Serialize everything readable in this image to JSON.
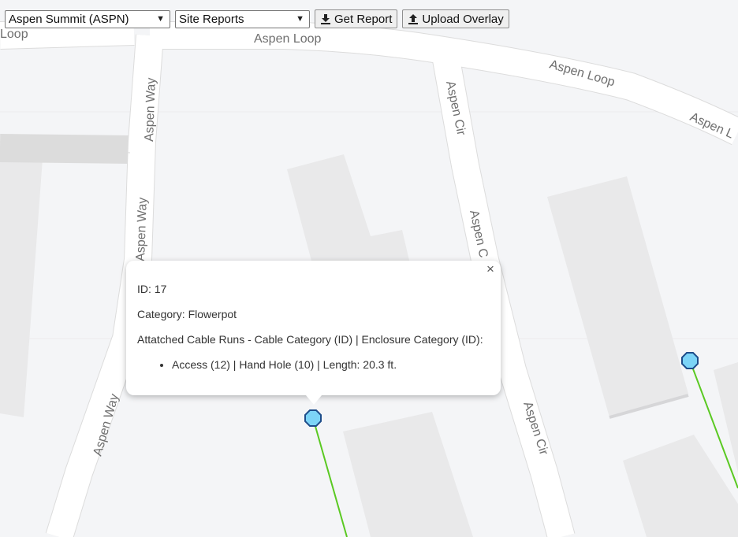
{
  "toolbar": {
    "site_select_value": "Aspen Summit (ASPN)",
    "report_select_value": "Site Reports",
    "get_report_label": "Get Report",
    "upload_overlay_label": "Upload Overlay"
  },
  "map": {
    "road_labels": [
      "Loop",
      "Aspen Loop",
      "Aspen Way",
      "Aspen Way",
      "Aspen Cir",
      "Aspen Loop",
      "Aspen L",
      "Aspen C",
      "Aspen Way",
      "Aspen Cir"
    ],
    "colors": {
      "background": "#f4f5f7",
      "road": "#ffffff",
      "road_edge": "#dcdcdc",
      "building": "#e9e9ea",
      "marker_fill": "#7cd4f7",
      "marker_stroke": "#1e4d8a",
      "cable": "#5ac922"
    }
  },
  "popup": {
    "id_line": "ID: 17",
    "category_line": "Category: Flowerpot",
    "attached_header": "Attatched Cable Runs - Cable Category (ID) | Enclosure Category (ID):",
    "cable_runs": [
      "Access (12) | Hand Hole (10) | Length: 20.3 ft."
    ],
    "close_symbol": "×"
  }
}
